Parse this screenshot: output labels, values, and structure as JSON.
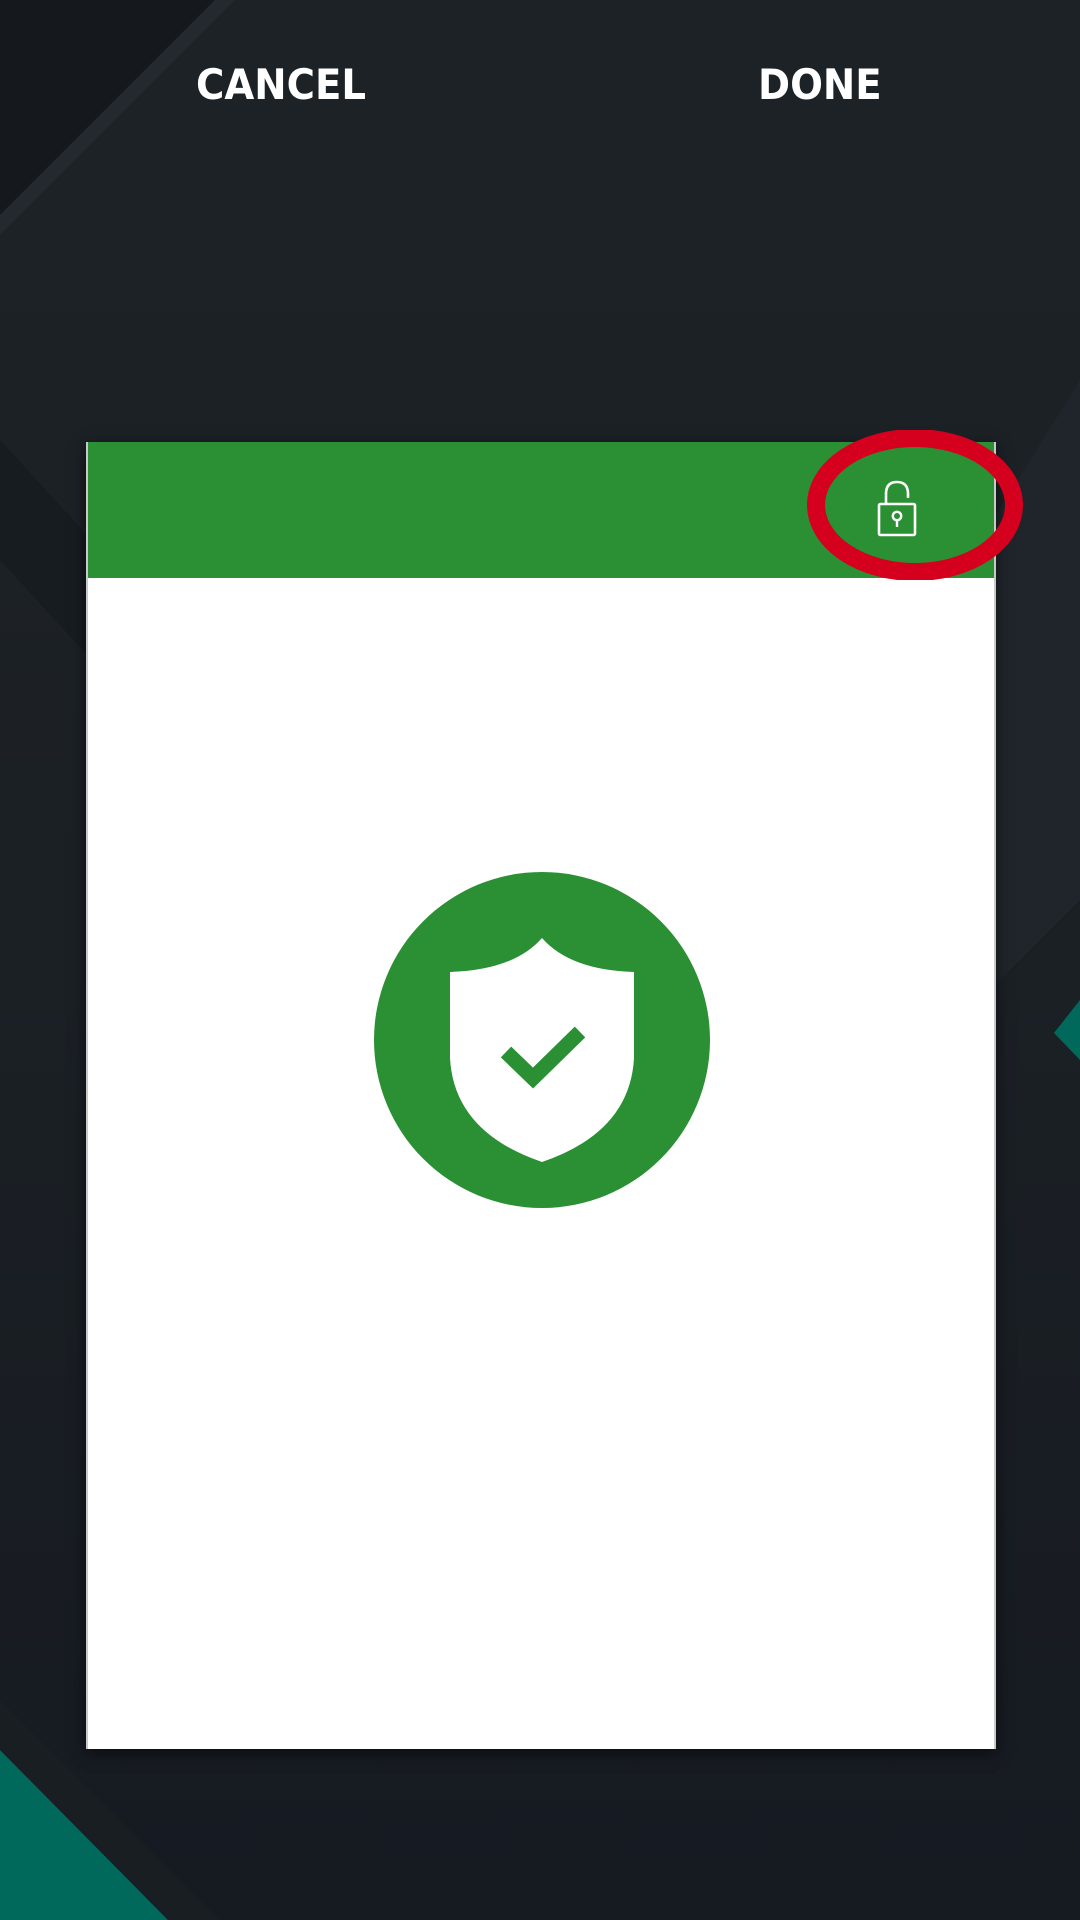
{
  "toolbar": {
    "cancel_label": "CANCEL",
    "done_label": "DONE"
  },
  "preview": {
    "header_color": "#2a9033",
    "lock_icon": "unlocked-padlock-icon",
    "status_icon": "shield-check-icon",
    "status_color": "#2a9033"
  },
  "annotation": {
    "highlight_color": "#d4001e"
  },
  "background": {
    "base_color": "#1c2126",
    "accent_color": "#00695c"
  }
}
